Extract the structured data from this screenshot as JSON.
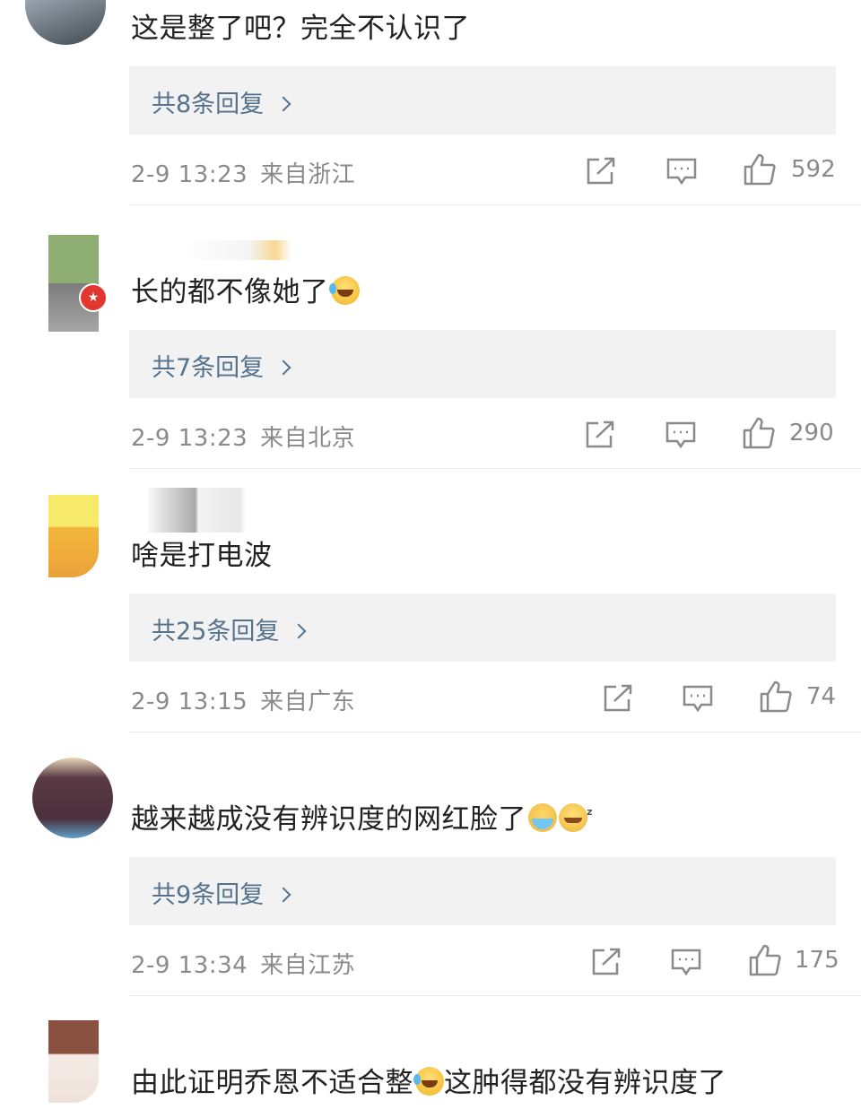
{
  "comments": [
    {
      "text": "这是整了吧？完全不认识了",
      "replies_label": "共8条回复",
      "time": "2-9 13:23",
      "location": "来自浙江",
      "likes": "592"
    },
    {
      "text": "长的都不像她了",
      "emoji": "tear-laugh-icon",
      "replies_label": "共7条回复",
      "time": "2-9 13:23",
      "location": "来自北京",
      "likes": "290"
    },
    {
      "text": "啥是打电波",
      "replies_label": "共25条回复",
      "time": "2-9 13:15",
      "location": "来自广东",
      "likes": "74"
    },
    {
      "text": "越来越成没有辨识度的网红脸了",
      "emoji": [
        "crying-face-icon",
        "dizzy-face-icon"
      ],
      "replies_label": "共9条回复",
      "time": "2-9 13:34",
      "location": "来自江苏",
      "likes": "175"
    },
    {
      "text_a": "由此证明乔恩不适合整",
      "emoji": "tear-laugh-icon",
      "text_b": "这肿得都没有辨识度了"
    }
  ],
  "colors": {
    "reply_link": "#55728c",
    "meta_gray": "#8a8a8a",
    "reply_bg": "#f2f2f2"
  }
}
